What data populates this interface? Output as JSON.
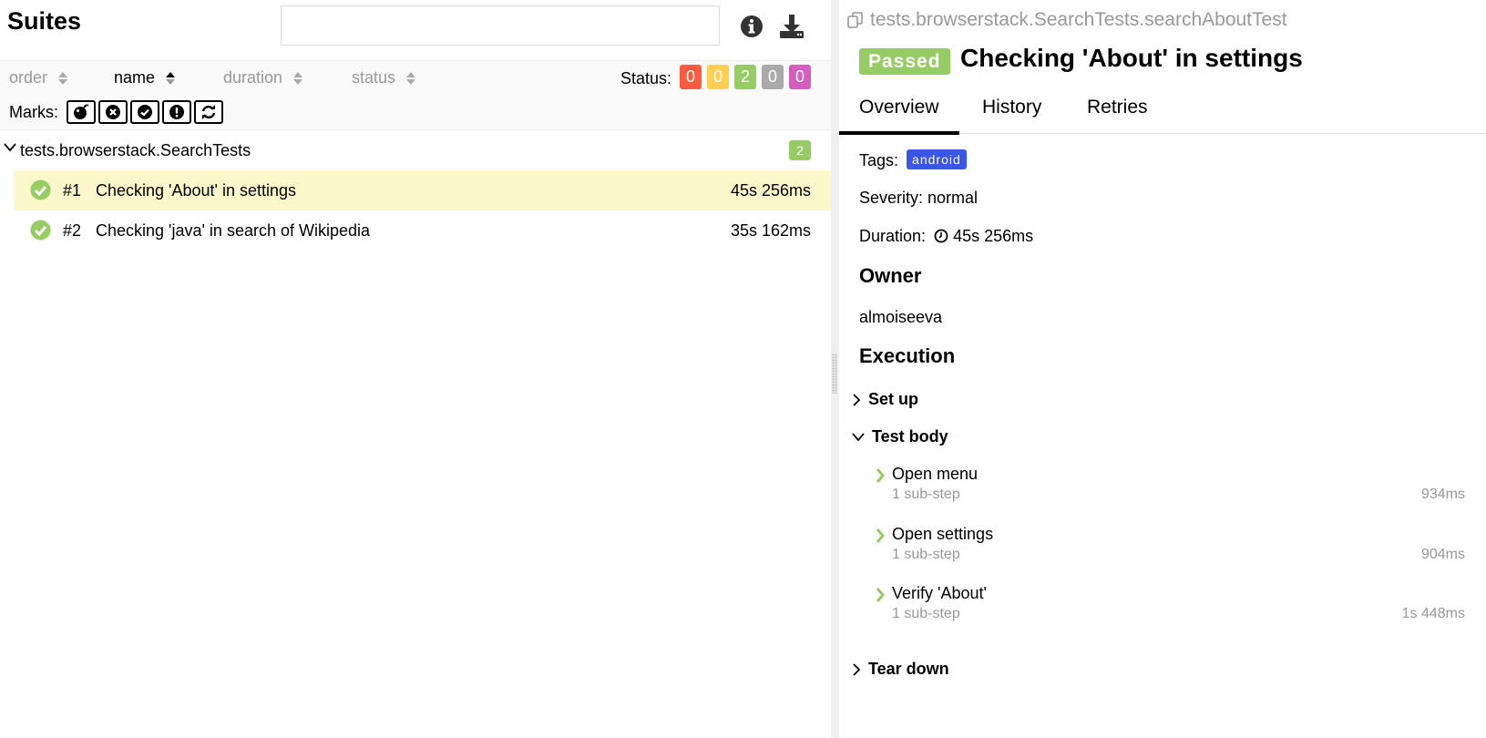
{
  "left": {
    "title": "Suites",
    "search": {
      "placeholder": "",
      "value": ""
    },
    "sort": {
      "order_label": "order",
      "name_label": "name",
      "duration_label": "duration",
      "status_label": "status",
      "active": "name"
    },
    "status": {
      "label": "Status:",
      "counts": [
        {
          "key": "failed",
          "value": "0",
          "color": "#fd5a3e"
        },
        {
          "key": "broken",
          "value": "0",
          "color": "#ffd050"
        },
        {
          "key": "passed",
          "value": "2",
          "color": "#97cc64"
        },
        {
          "key": "skipped",
          "value": "0",
          "color": "#aaaaaa"
        },
        {
          "key": "unknown",
          "value": "0",
          "color": "#d35ebe"
        }
      ]
    },
    "marks": {
      "label": "Marks:",
      "icons": [
        "bomb-icon",
        "times-circle-icon",
        "check-circle-icon",
        "exclamation-circle-icon",
        "refresh-icon"
      ]
    },
    "group": {
      "name": "tests.browserstack.SearchTests",
      "count": "2"
    },
    "tests": [
      {
        "num": "#1",
        "name": "Checking 'About' in settings",
        "duration": "45s 256ms",
        "selected": true
      },
      {
        "num": "#2",
        "name": "Checking 'java' in search of Wikipedia",
        "duration": "35s 162ms",
        "selected": false
      }
    ]
  },
  "right": {
    "fullname": "tests.browserstack.SearchTests.searchAboutTest",
    "status_badge": "Passed",
    "title": "Checking 'About' in settings",
    "tabs": [
      "Overview",
      "History",
      "Retries"
    ],
    "active_tab": "Overview",
    "tags_label": "Tags:",
    "tags": [
      "android"
    ],
    "severity": "Severity: normal",
    "duration_label": "Duration:",
    "duration_value": "45s 256ms",
    "owner_heading": "Owner",
    "owner": "almoiseeva",
    "execution_heading": "Execution",
    "setup_label": "Set up",
    "testbody_label": "Test body",
    "teardown_label": "Tear down",
    "steps": [
      {
        "name": "Open menu",
        "substeps": "1 sub-step",
        "time": "934ms"
      },
      {
        "name": "Open settings",
        "substeps": "1 sub-step",
        "time": "904ms"
      },
      {
        "name": "Verify 'About'",
        "substeps": "1 sub-step",
        "time": "1s 448ms"
      }
    ],
    "colors": {
      "passed": "#97cc64",
      "tag": "#3b55e6",
      "selected_row": "#fdf8cc"
    }
  }
}
